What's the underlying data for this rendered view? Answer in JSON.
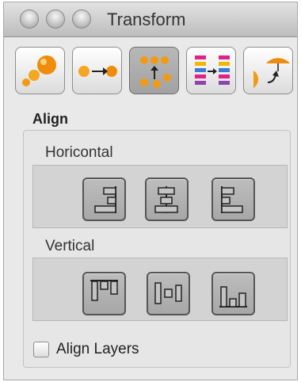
{
  "window": {
    "title": "Transform"
  },
  "toolbar": {
    "tools": [
      {
        "icon": "scale-spheres-icon",
        "selected": false
      },
      {
        "icon": "move-spheres-icon",
        "selected": false
      },
      {
        "icon": "align-spheres-icon",
        "selected": true
      },
      {
        "icon": "distribute-bars-icon",
        "selected": false
      },
      {
        "icon": "rotate-umbrella-icon",
        "selected": false
      }
    ]
  },
  "align": {
    "section_label": "Align",
    "horizontal": {
      "label": "Horicontal",
      "buttons": [
        "align-right-icon",
        "align-center-icon",
        "align-left-icon"
      ]
    },
    "vertical": {
      "label": "Vertical",
      "buttons": [
        "align-top-icon",
        "align-middle-icon",
        "align-bottom-icon"
      ]
    },
    "align_layers": {
      "label": "Align Layers",
      "checked": false
    }
  },
  "colors": {
    "accent_orange": "#f29a12",
    "panel_bg": "#e9e9e9"
  }
}
